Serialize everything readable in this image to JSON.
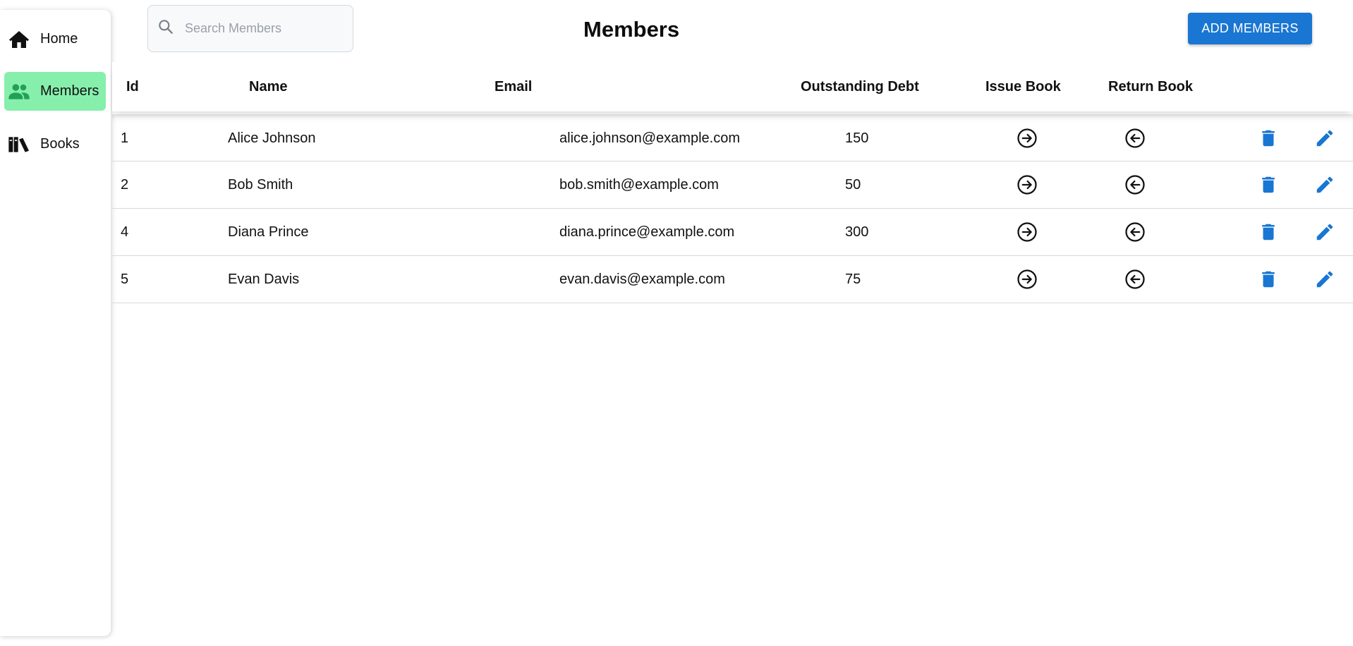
{
  "sidebar": {
    "items": [
      {
        "label": "Home",
        "icon": "home-icon",
        "active": false
      },
      {
        "label": "Members",
        "icon": "people-icon",
        "active": true
      },
      {
        "label": "Books",
        "icon": "books-icon",
        "active": false
      }
    ]
  },
  "search": {
    "placeholder": "Search Members",
    "value": ""
  },
  "header": {
    "title": "Members",
    "add_label": "ADD MEMBERS"
  },
  "table": {
    "columns": [
      "Id",
      "Name",
      "Email",
      "Outstanding Debt",
      "Issue Book",
      "Return Book"
    ],
    "rows": [
      {
        "id": "1",
        "name": "Alice Johnson",
        "email": "alice.johnson@example.com",
        "debt": "150"
      },
      {
        "id": "2",
        "name": "Bob Smith",
        "email": "bob.smith@example.com",
        "debt": "50"
      },
      {
        "id": "4",
        "name": "Diana Prince",
        "email": "diana.prince@example.com",
        "debt": "300"
      },
      {
        "id": "5",
        "name": "Evan Davis",
        "email": "evan.davis@example.com",
        "debt": "75"
      }
    ]
  },
  "colors": {
    "accent": "#1976d2",
    "active_nav": "#86efac",
    "members_icon": "#22a055"
  },
  "icons": {
    "issue": "arrow-right-circle-icon",
    "return": "arrow-left-circle-icon",
    "delete": "trash-icon",
    "edit": "pencil-icon"
  }
}
